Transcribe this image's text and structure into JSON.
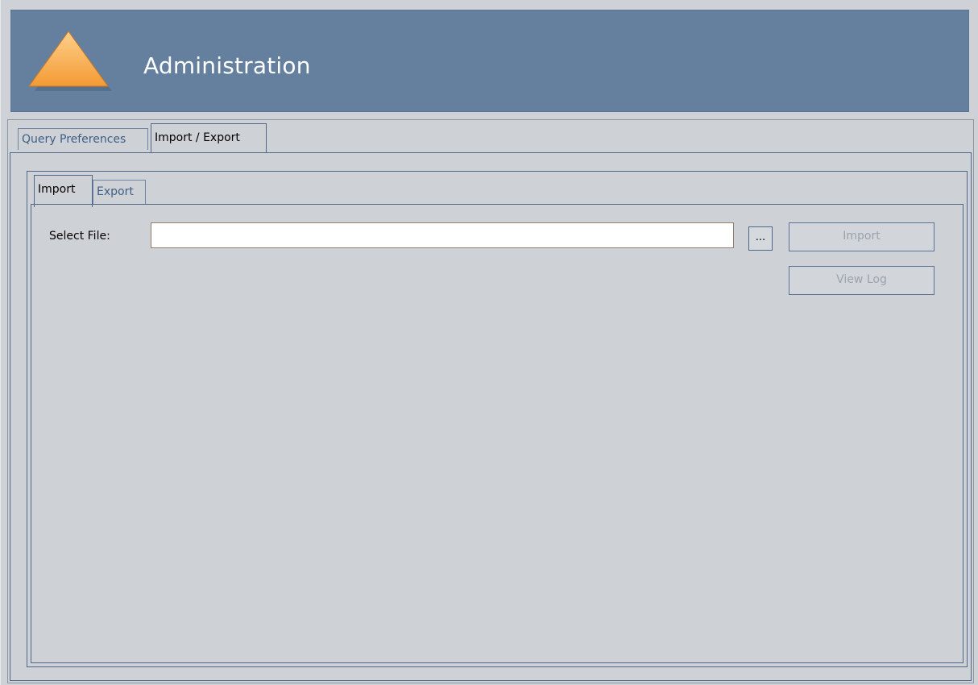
{
  "header": {
    "title": "Administration",
    "icon": "warning-triangle-icon",
    "background_color": "#65809f"
  },
  "main_tabs": [
    {
      "label": "Query Preferences",
      "active": false
    },
    {
      "label": "Import / Export",
      "active": true
    }
  ],
  "sub_tabs": [
    {
      "label": "Import",
      "active": true
    },
    {
      "label": "Export",
      "active": false
    }
  ],
  "import_panel": {
    "select_file_label": "Select File:",
    "file_value": "",
    "browse_label": "...",
    "import_button": "Import",
    "view_log_button": "View Log"
  }
}
